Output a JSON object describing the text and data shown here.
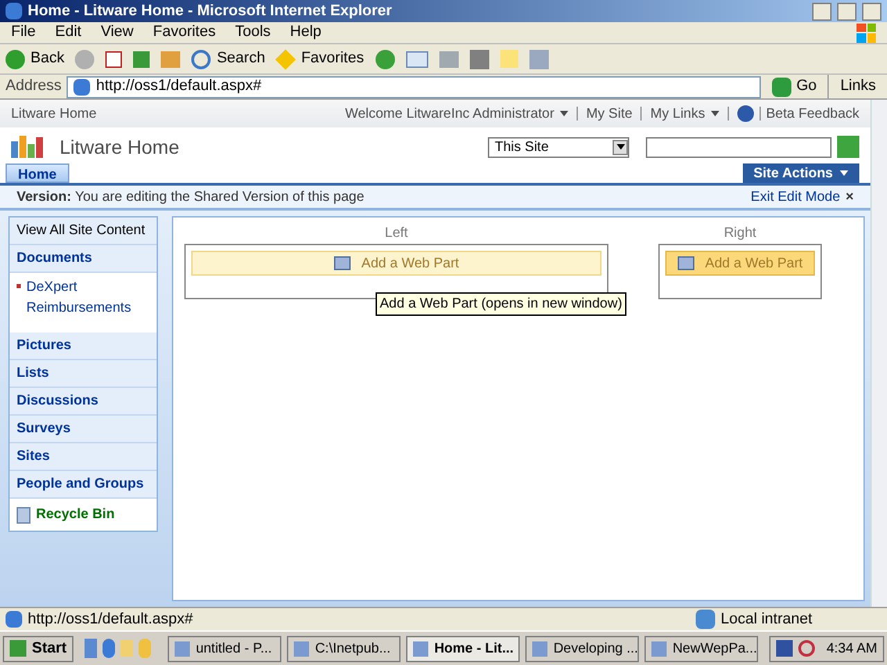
{
  "window": {
    "title": "Home - Litware Home - Microsoft Internet Explorer"
  },
  "menu_bar": [
    "File",
    "Edit",
    "View",
    "Favorites",
    "Tools",
    "Help"
  ],
  "toolbar": [
    {
      "label": "Back",
      "kind": "back"
    },
    {
      "label": "Search",
      "kind": "search"
    },
    {
      "label": "Favorites",
      "kind": "favorites"
    }
  ],
  "address_bar": {
    "label": "Address",
    "value": "http://oss1/default.aspx#",
    "go": "Go",
    "links": "Links"
  },
  "page": {
    "breadcrumb": "Litware Home",
    "top_links": [
      {
        "label": "Welcome LitwareInc Administrator",
        "menu": true
      },
      {
        "label": "My Site",
        "menu": false
      },
      {
        "label": "My Links",
        "menu": true
      },
      {
        "label": "Beta Feedback",
        "menu": false
      }
    ],
    "site_title": "Litware Home",
    "search_scope": "This Site",
    "tabs": [
      {
        "label": "Home",
        "selected": true
      }
    ],
    "site_actions": "Site Actions",
    "version_bar": {
      "label": "Version:",
      "text": "You are editing the Shared Version of this page",
      "exit": "Exit Edit Mode",
      "close": "×"
    },
    "sidebar": {
      "view_all": "View All Site Content",
      "sections": [
        {
          "label": "Documents",
          "children": [
            "DeXpert Reimbursements"
          ]
        },
        {
          "label": "Pictures"
        },
        {
          "label": "Lists"
        },
        {
          "label": "Discussions"
        },
        {
          "label": "Surveys"
        },
        {
          "label": "Sites"
        },
        {
          "label": "People and Groups"
        }
      ],
      "recycle_bin": "Recycle Bin"
    },
    "zones": [
      {
        "title": "Left",
        "button": "Add a Web Part",
        "hover": false
      },
      {
        "title": "Right",
        "button": "Add a Web Part",
        "hover": true
      }
    ],
    "tooltip": "Add a Web Part (opens in new window)"
  },
  "status_bar": {
    "url": "http://oss1/default.aspx#",
    "zone": "Local intranet"
  },
  "taskbar": {
    "start": "Start",
    "tasks": [
      {
        "label": "untitled - P...",
        "selected": false
      },
      {
        "label": "C:\\Inetpub...",
        "selected": false
      },
      {
        "label": "Home - Lit...",
        "selected": true
      },
      {
        "label": "Developing ...",
        "selected": false
      },
      {
        "label": "NewWepPa...",
        "selected": false
      }
    ],
    "clock": "4:34 AM"
  }
}
